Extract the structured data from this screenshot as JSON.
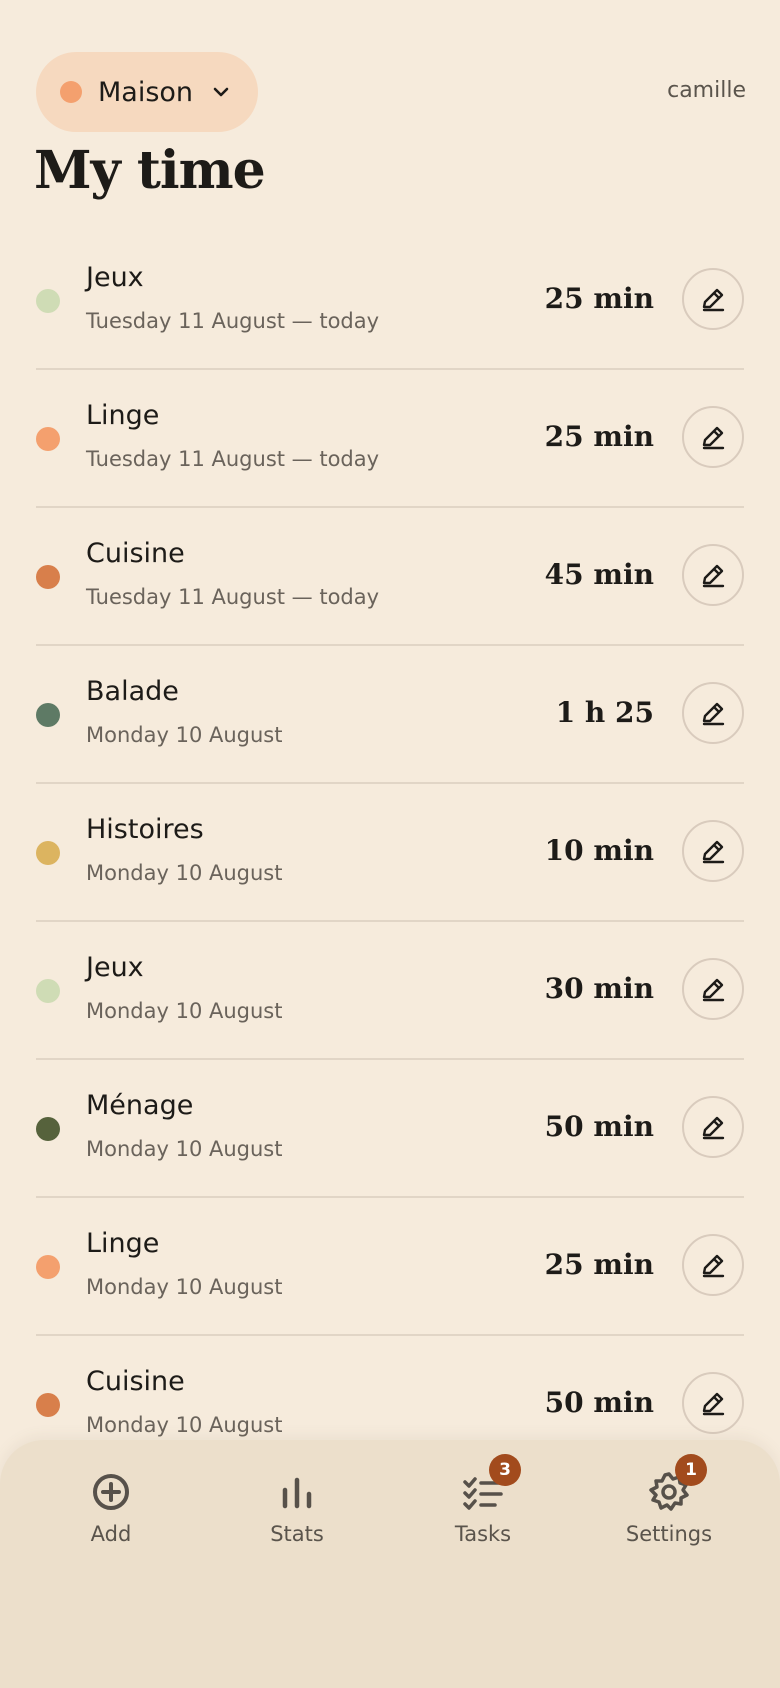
{
  "header": {
    "space_name": "Maison",
    "space_color": "#f4a06e",
    "username": "camille",
    "title": "My time"
  },
  "entries": [
    {
      "name": "Jeux",
      "date": "Tuesday 11 August — today",
      "duration": "25 min",
      "color": "#cfdcb5"
    },
    {
      "name": "Linge",
      "date": "Tuesday 11 August — today",
      "duration": "25 min",
      "color": "#f4a06e"
    },
    {
      "name": "Cuisine",
      "date": "Tuesday 11 August — today",
      "duration": "45 min",
      "color": "#d87f4b"
    },
    {
      "name": "Balade",
      "date": "Monday 10 August",
      "duration": "1 h 25",
      "color": "#5e7a65"
    },
    {
      "name": "Histoires",
      "date": "Monday 10 August",
      "duration": "10 min",
      "color": "#dcb460"
    },
    {
      "name": "Jeux",
      "date": "Monday 10 August",
      "duration": "30 min",
      "color": "#cfdcb5"
    },
    {
      "name": "Ménage",
      "date": "Monday 10 August",
      "duration": "50 min",
      "color": "#56623c"
    },
    {
      "name": "Linge",
      "date": "Monday 10 August",
      "duration": "25 min",
      "color": "#f4a06e"
    },
    {
      "name": "Cuisine",
      "date": "Monday 10 August",
      "duration": "50 min",
      "color": "#d87f4b"
    }
  ],
  "nav": {
    "add_label": "Add",
    "stats_label": "Stats",
    "tasks_label": "Tasks",
    "tasks_badge": "3",
    "settings_label": "Settings",
    "settings_badge": "1"
  },
  "colors": {
    "background": "#f6ebdc",
    "badge": "#a24b1d"
  }
}
